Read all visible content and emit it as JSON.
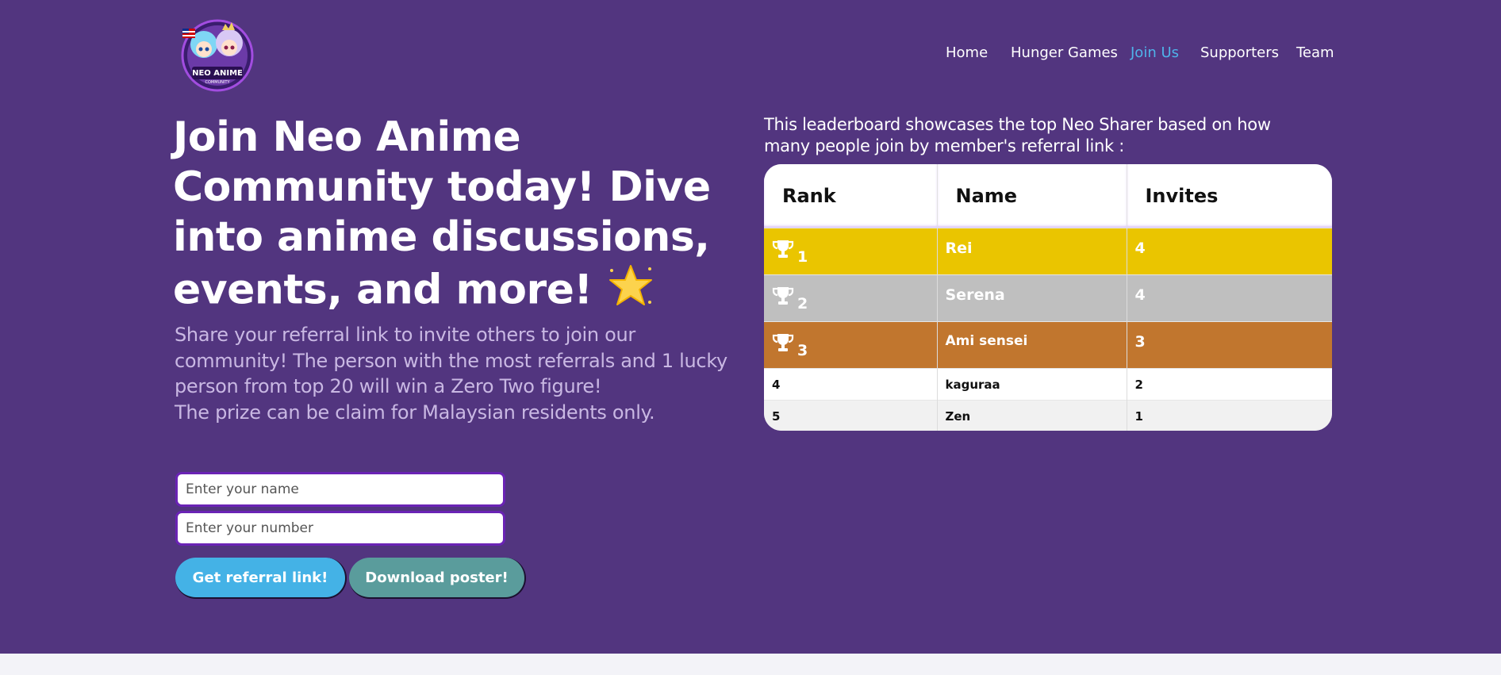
{
  "nav": {
    "items": [
      {
        "label": "Home",
        "active": false
      },
      {
        "label": "Hunger Games",
        "active": false
      },
      {
        "label": "Join Us",
        "active": true
      },
      {
        "label": "Supporters",
        "active": false
      },
      {
        "label": "Team",
        "active": false
      }
    ]
  },
  "logo": {
    "text": "NEO ANIME",
    "subtext": "COMMUNITY"
  },
  "hero": {
    "headline": "Join Neo Anime Community today! Dive into anime discussions, events, and more!",
    "headline_icon": "glowing-star-icon",
    "subtext_line1": "Share your referral link to invite others to join our community! The person with the most referrals and 1 lucky person from top 20 will win a Zero Two figure!",
    "subtext_line2": "The prize can be claim for Malaysian residents only."
  },
  "form": {
    "name_placeholder": "Enter your name",
    "number_placeholder": "Enter your number",
    "referral_button": "Get referral link!",
    "poster_button": "Download poster!"
  },
  "leaderboard": {
    "intro": "This leaderboard showcases the top Neo Sharer based on how many people join by member's referral link :",
    "headers": {
      "rank": "Rank",
      "name": "Name",
      "invites": "Invites"
    },
    "rows": [
      {
        "rank": "1",
        "name": "Rei",
        "invites": "4"
      },
      {
        "rank": "2",
        "name": "Serena",
        "invites": "4"
      },
      {
        "rank": "3",
        "name": "Ami sensei",
        "invites": "3"
      },
      {
        "rank": "4",
        "name": "kaguraa",
        "invites": "2"
      },
      {
        "rank": "5",
        "name": "Zen",
        "invites": "1"
      }
    ]
  },
  "colors": {
    "background": "#52357f",
    "gold": "#eac500",
    "silver": "#bfbfbf",
    "bronze": "#c1762e",
    "referral_button": "#44b2e6",
    "poster_button": "#5a9c9c",
    "active_nav": "#4fb3ea"
  }
}
